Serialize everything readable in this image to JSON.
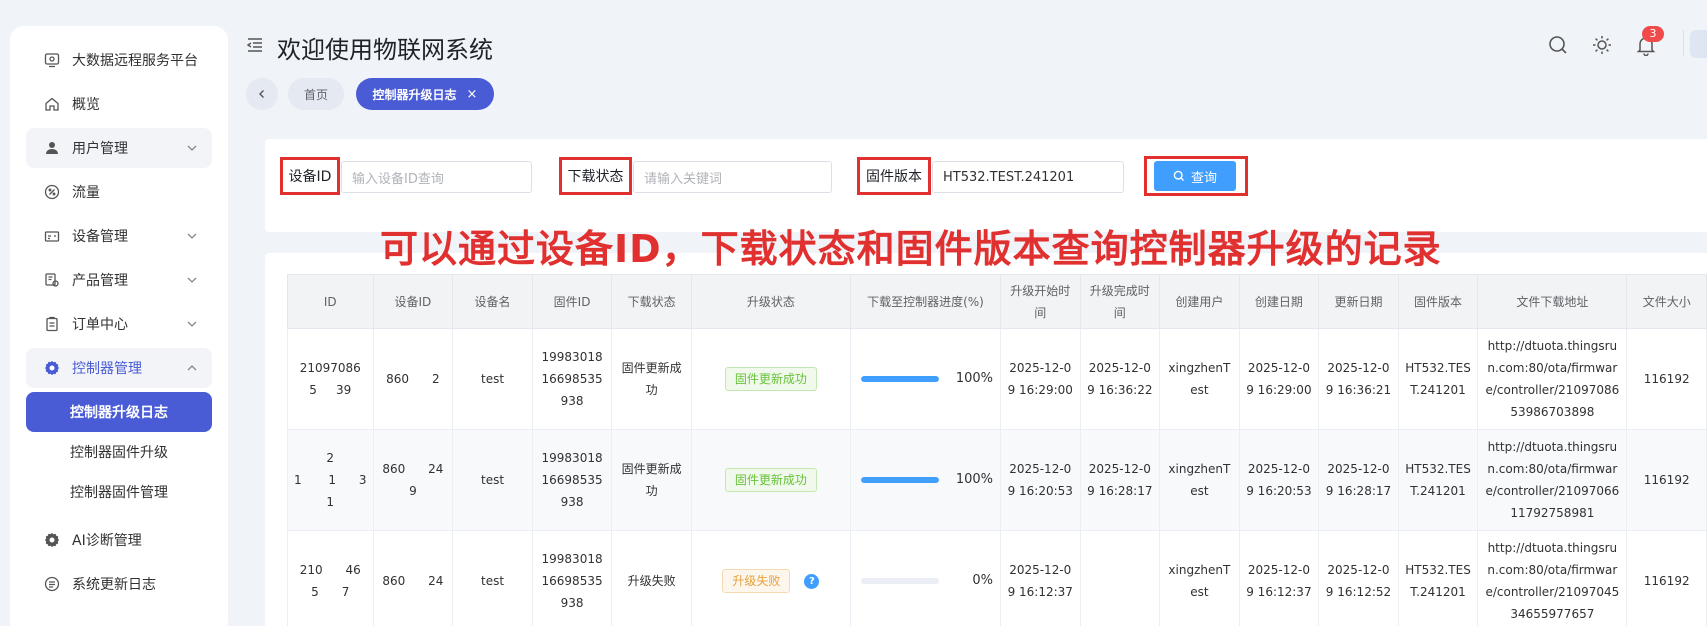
{
  "colors": {
    "accent": "#4a5bd6",
    "primary_button": "#409eff",
    "annotation_red": "#e0302f",
    "badge_red": "#f04b4b"
  },
  "sidebar": {
    "items": [
      {
        "label": "大数据远程服务平台",
        "icon": "monitor-icon"
      },
      {
        "label": "概览",
        "icon": "home-icon"
      },
      {
        "label": "用户管理",
        "icon": "user-icon",
        "expandable": true
      },
      {
        "label": "流量",
        "icon": "percent-icon"
      },
      {
        "label": "设备管理",
        "icon": "device-icon",
        "expandable": true
      },
      {
        "label": "产品管理",
        "icon": "product-icon",
        "expandable": true
      },
      {
        "label": "订单中心",
        "icon": "clipboard-icon",
        "expandable": true
      },
      {
        "label": "控制器管理",
        "icon": "gear-icon",
        "expandable": true,
        "open": true
      }
    ],
    "subitems": [
      {
        "label": "控制器升级日志",
        "active": true
      },
      {
        "label": "控制器固件升级"
      },
      {
        "label": "控制器固件管理"
      }
    ],
    "bottom_items": [
      {
        "label": "AI诊断管理",
        "icon": "gear-icon"
      },
      {
        "label": "系统更新日志",
        "icon": "list-icon"
      }
    ]
  },
  "header": {
    "title": "欢迎使用物联网系统",
    "notification_count": "3"
  },
  "tabs": {
    "home": "首页",
    "active": "控制器升级日志",
    "close": "×"
  },
  "filters": {
    "device_id_label": "设备ID",
    "device_id_placeholder": "输入设备ID查询",
    "download_status_label": "下载状态",
    "download_status_placeholder": "请输入关键词",
    "firmware_label": "固件版本",
    "firmware_value": "HT532.TEST.241201",
    "search_button": "查询"
  },
  "annotation": "可以通过设备ID，下载状态和固件版本查询控制器升级的记录",
  "table": {
    "columns": [
      "ID",
      "设备ID",
      "设备名",
      "固件ID",
      "下载状态",
      "升级状态",
      "下载至控制器进度(%)",
      "升级开始时间",
      "升级完成时间",
      "创建用户",
      "创建日期",
      "更新日期",
      "固件版本",
      "文件下载地址",
      "文件大小"
    ],
    "rows": [
      {
        "id": "210970865     39",
        "device_id": "860      2",
        "device_name": "test",
        "firmware_id": "1998301816698535938",
        "download_status": "固件更新成功",
        "upgrade_status": "固件更新成功",
        "upgrade_status_type": "ok",
        "progress": 100,
        "progress_label": "100%",
        "start_time": "2025-12-09 16:29:00",
        "finish_time": "2025-12-09 16:36:22",
        "creator": "xingzhenTest",
        "created": "2025-12-09 16:29:00",
        "updated": "2025-12-09 16:36:21",
        "firmware": "HT532.TEST.241201",
        "url": "http://dtuota.thingsrun.com:80/ota/firmware/controller/2109708653986703898",
        "size": "116192"
      },
      {
        "id": "21       1      3 1",
        "device_id": "860      249",
        "device_name": "test",
        "firmware_id": "1998301816698535938",
        "download_status": "固件更新成功",
        "upgrade_status": "固件更新成功",
        "upgrade_status_type": "ok",
        "progress": 100,
        "progress_label": "100%",
        "start_time": "2025-12-09 16:20:53",
        "finish_time": "2025-12-09 16:28:17",
        "creator": "xingzhenTest",
        "created": "2025-12-09 16:20:53",
        "updated": "2025-12-09 16:28:17",
        "firmware": "HT532.TEST.241201",
        "url": "http://dtuota.thingsrun.com:80/ota/firmware/controller/2109706611792758981",
        "size": "116192"
      },
      {
        "id": "210      465      7",
        "device_id": "860      24",
        "device_name": "test",
        "firmware_id": "1998301816698535938",
        "download_status": "升级失败",
        "upgrade_status": "升级失败",
        "upgrade_status_type": "fail",
        "progress": 0,
        "progress_label": "0%",
        "start_time": "2025-12-09 16:12:37",
        "finish_time": "",
        "creator": "xingzhenTest",
        "created": "2025-12-09 16:12:37",
        "updated": "2025-12-09 16:12:52",
        "firmware": "HT532.TEST.241201",
        "url": "http://dtuota.thingsrun.com:80/ota/firmware/controller/2109704534655977657",
        "size": "116192"
      }
    ]
  }
}
